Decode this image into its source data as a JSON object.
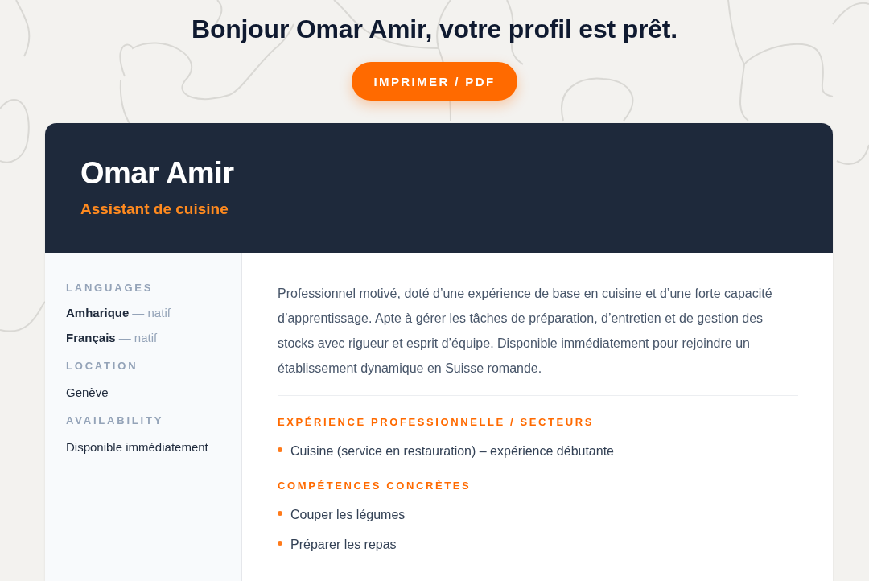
{
  "greeting": "Bonjour Omar Amir, votre profil est prêt.",
  "print_button": "IMPRIMER / PDF",
  "profile": {
    "name": "Omar Amir",
    "title": "Assistant de cuisine"
  },
  "sidebar": {
    "sections": [
      {
        "kind": "languages",
        "heading": "LANGUAGES",
        "items": [
          {
            "language": "Amharique",
            "proficiency": "— natif"
          },
          {
            "language": "Français",
            "proficiency": "— natif"
          }
        ]
      },
      {
        "kind": "text",
        "heading": "LOCATION",
        "value": "Genève"
      },
      {
        "kind": "text",
        "heading": "AVAILABILITY",
        "value": "Disponible immédiatement"
      }
    ]
  },
  "main": {
    "summary": "Professionnel motivé, doté d’une expérience de base en cuisine et d’une forte capacité d’apprentissage. Apte à gérer les tâches de préparation, d’entretien et de gestion des stocks avec rigueur et esprit d’équipe. Disponible immédiatement pour rejoindre un établissement dynamique en Suisse romande.",
    "sections": [
      {
        "heading": "EXPÉRIENCE PROFESSIONNELLE / SECTEURS",
        "items": [
          "Cuisine (service en restauration) – expérience débutante"
        ]
      },
      {
        "heading": "COMPÉTENCES CONCRÈTES",
        "items": [
          "Couper les légumes",
          "Préparer les repas"
        ]
      }
    ]
  }
}
